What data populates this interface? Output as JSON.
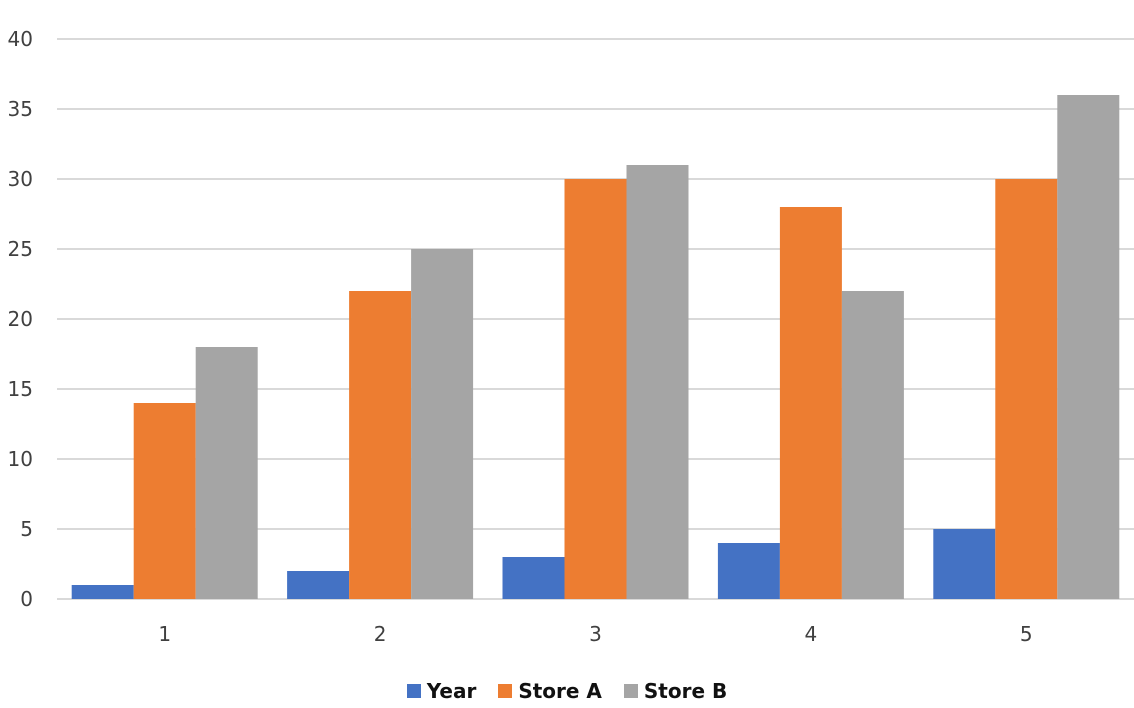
{
  "chart_data": {
    "type": "bar",
    "title": "",
    "xlabel": "",
    "ylabel": "",
    "categories": [
      "1",
      "2",
      "3",
      "4",
      "5"
    ],
    "series": [
      {
        "name": "Year",
        "color": "#4472C4",
        "values": [
          1,
          2,
          3,
          4,
          5
        ]
      },
      {
        "name": "Store A",
        "color": "#ED7D31",
        "values": [
          14,
          22,
          30,
          28,
          30
        ]
      },
      {
        "name": "Store B",
        "color": "#A5A5A5",
        "values": [
          18,
          25,
          31,
          22,
          36
        ]
      }
    ],
    "ylim": [
      0,
      40
    ],
    "yticks": [
      "0",
      "5",
      "10",
      "15",
      "20",
      "25",
      "30",
      "35",
      "40"
    ],
    "grid": true,
    "legend": "bottom-center"
  }
}
